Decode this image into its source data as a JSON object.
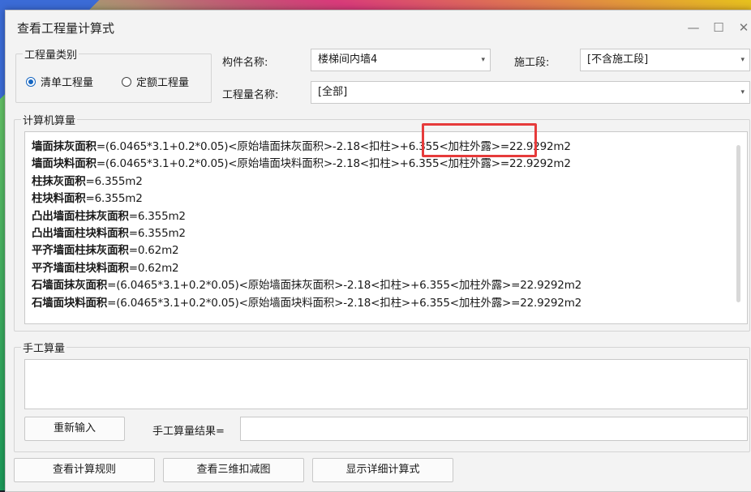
{
  "window": {
    "title": "查看工程量计算式",
    "minimize_icon": "minimize-icon",
    "maximize_icon": "maximize-icon",
    "close_icon": "close-icon",
    "min_glyph": "—",
    "max_glyph": "☐",
    "close_glyph": "✕"
  },
  "quantity_type": {
    "group_label": "工程量类别",
    "options": [
      {
        "label": "清单工程量",
        "checked": true
      },
      {
        "label": "定额工程量",
        "checked": false
      }
    ]
  },
  "fields": {
    "component_name_label": "构件名称:",
    "component_name_value": "楼梯间内墙4",
    "construction_stage_label": "施工段:",
    "construction_stage_value": "[不含施工段]",
    "quantity_name_label": "工程量名称:",
    "quantity_name_value": "[全部]"
  },
  "computer_calc": {
    "group_label": "计算机算量",
    "lines": [
      {
        "name": "墙面抹灰面积",
        "formula": "=(6.0465*3.1+0.2*0.05)<原始墙面抹灰面积>-2.18<扣柱>+6.355<加柱外露>=22.9292m2"
      },
      {
        "name": "墙面块料面积",
        "formula": "=(6.0465*3.1+0.2*0.05)<原始墙面块料面积>-2.18<扣柱>+6.355<加柱外露>=22.9292m2"
      },
      {
        "name": "柱抹灰面积",
        "formula": "=6.355m2"
      },
      {
        "name": "柱块料面积",
        "formula": "=6.355m2"
      },
      {
        "name": "凸出墙面柱抹灰面积",
        "formula": "=6.355m2"
      },
      {
        "name": "凸出墙面柱块料面积",
        "formula": "=6.355m2"
      },
      {
        "name": "平齐墙面柱抹灰面积",
        "formula": "=0.62m2"
      },
      {
        "name": "平齐墙面柱块料面积",
        "formula": "=0.62m2"
      },
      {
        "name": "石墙面抹灰面积",
        "formula": "=(6.0465*3.1+0.2*0.05)<原始墙面抹灰面积>-2.18<扣柱>+6.355<加柱外露>=22.9292m2"
      },
      {
        "name": "石墙面块料面积",
        "formula": "=(6.0465*3.1+0.2*0.05)<原始墙面块料面积>-2.18<扣柱>+6.355<加柱外露>=22.9292m2"
      }
    ]
  },
  "manual_calc": {
    "group_label": "手工算量",
    "reenter_button": "重新输入",
    "result_label": "手工算量结果=",
    "result_value": ""
  },
  "footer": {
    "view_rules": "查看计算规则",
    "view_3d": "查看三维扣减图",
    "show_detail": "显示详细计算式"
  },
  "colors": {
    "highlight": "#e63b3b",
    "radio_checked": "#1565c0"
  }
}
